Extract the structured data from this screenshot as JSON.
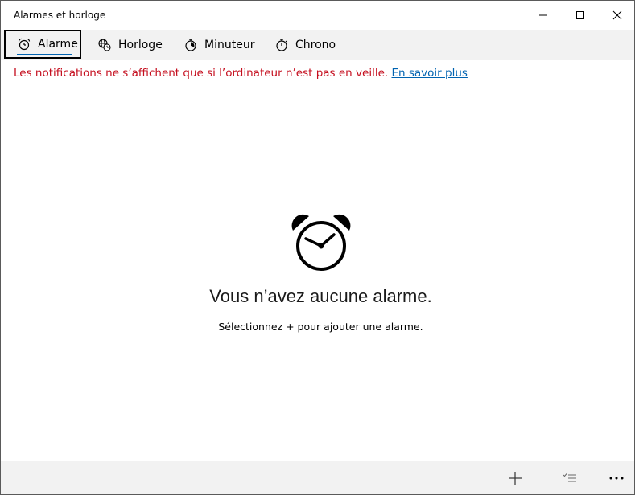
{
  "window": {
    "title": "Alarmes et horloge",
    "controls": [
      "minimize-icon",
      "maximize-icon",
      "close-icon"
    ]
  },
  "tabs": [
    {
      "label": "Alarme",
      "icon": "alarm-clock-icon",
      "selected": true
    },
    {
      "label": "Horloge",
      "icon": "world-clock-icon",
      "selected": false
    },
    {
      "label": "Minuteur",
      "icon": "timer-icon",
      "selected": false
    },
    {
      "label": "Chrono",
      "icon": "stopwatch-icon",
      "selected": false
    }
  ],
  "notice": {
    "text": "Les notifications ne s’affichent que si l’ordinateur n’est pas en veille.",
    "link": "En savoir plus",
    "color": "#c50f1f",
    "link_color": "#0063b1"
  },
  "empty_state": {
    "icon": "alarm-clock-icon",
    "title": "Vous n’avez aucune alarme.",
    "subtitle": "Sélectionnez + pour ajouter une alarme."
  },
  "command_bar": {
    "buttons": [
      "add-icon",
      "select-list-icon",
      "more-icon"
    ]
  },
  "colors": {
    "accent": "#0063b1",
    "chrome": "#f2f2f2"
  }
}
